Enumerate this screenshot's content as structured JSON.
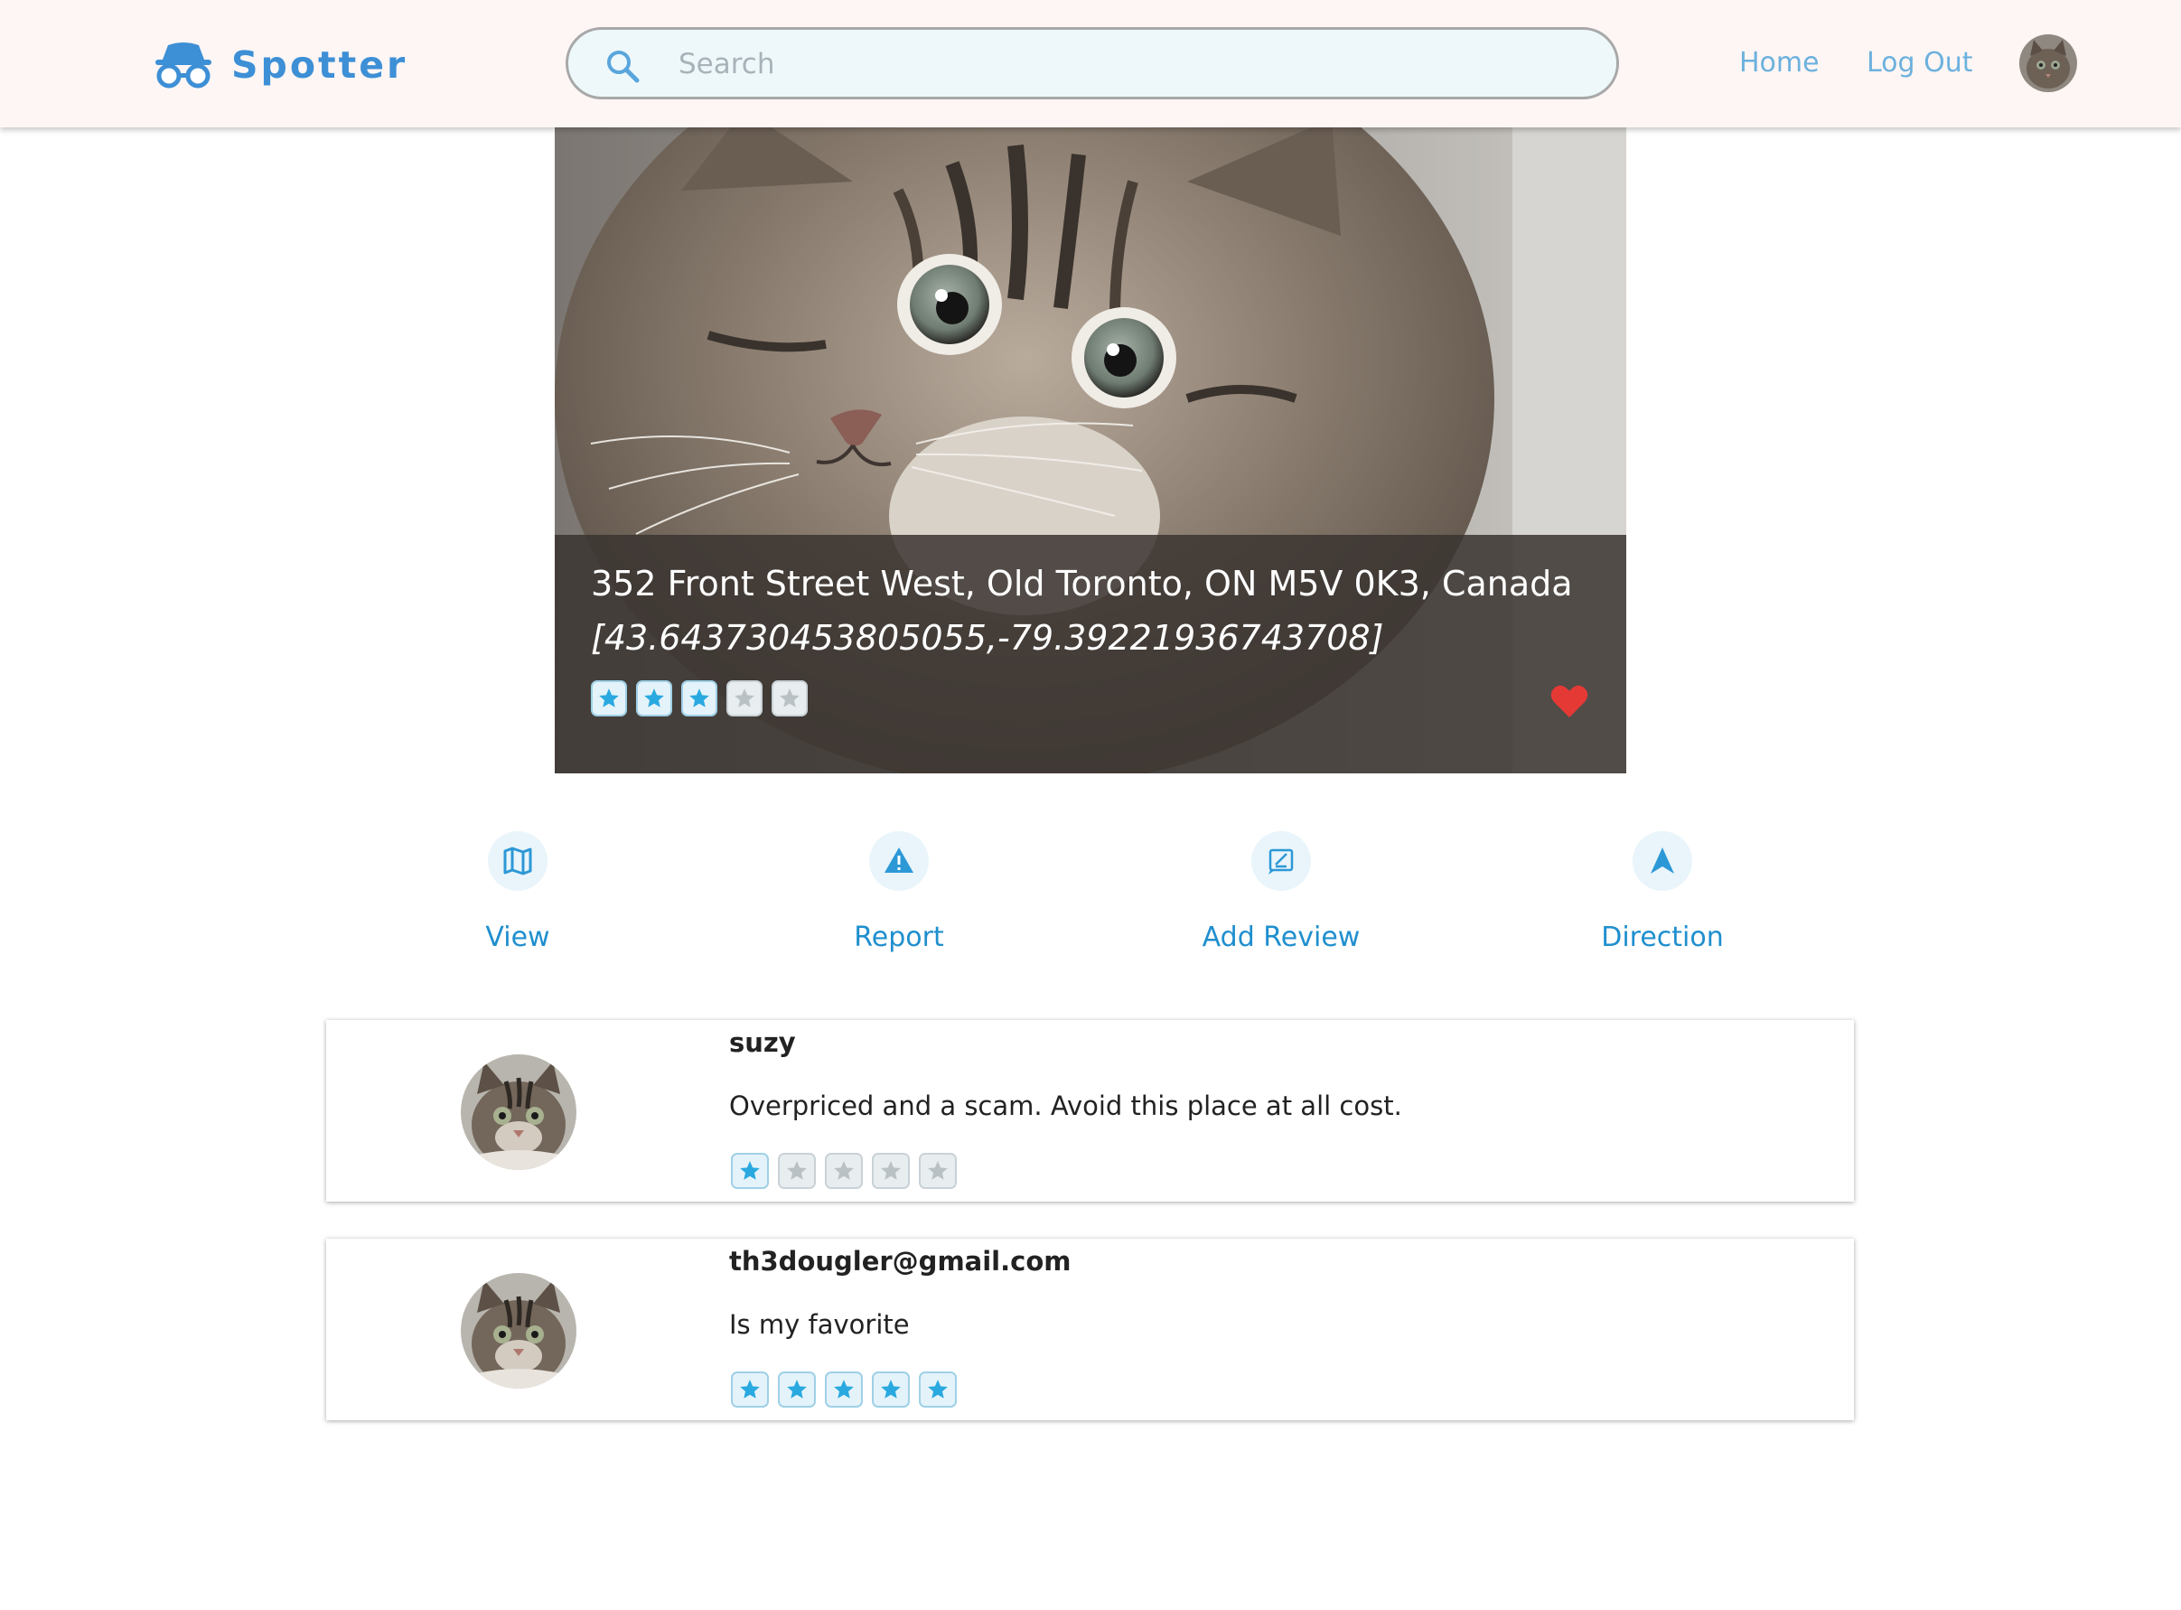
{
  "navbar": {
    "brand": "Spotter",
    "search_placeholder": "Search",
    "links": [
      {
        "label": "Home"
      },
      {
        "label": "Log Out"
      }
    ]
  },
  "spot": {
    "address": "352 Front Street West, Old Toronto, ON M5V 0K3, Canada",
    "coordinates": "[43.643730453805055,-79.39221936743708]",
    "rating": 3,
    "max_rating": 5,
    "favorited": true
  },
  "actions": [
    {
      "label": "View",
      "icon": "map-icon"
    },
    {
      "label": "Report",
      "icon": "warning-icon"
    },
    {
      "label": "Add Review",
      "icon": "review-icon"
    },
    {
      "label": "Direction",
      "icon": "navigation-arrow-icon"
    }
  ],
  "reviews": [
    {
      "user": "suzy",
      "text": "Overpriced and a scam. Avoid this place at all cost.",
      "rating": 1
    },
    {
      "user": "th3dougler@gmail.com",
      "text": "Is my favorite",
      "rating": 5
    }
  ],
  "colors": {
    "accent": "#3d8fd6",
    "link": "#6cb1de",
    "action_label": "#1f8fce",
    "star_on": "#2aa9e0",
    "star_off": "#b9c1c4",
    "heart": "#e53935",
    "navbar_bg": "#fdf6f4"
  }
}
